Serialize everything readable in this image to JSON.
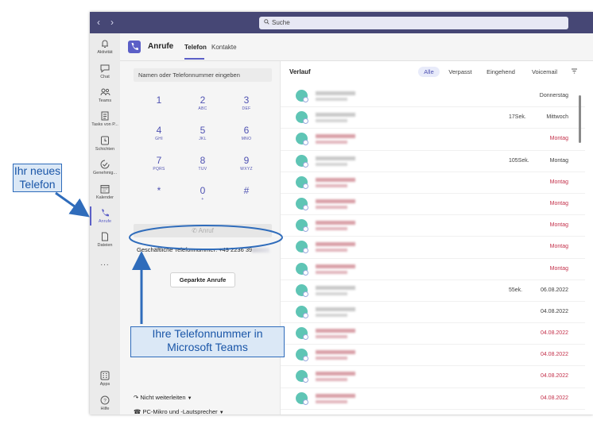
{
  "search": {
    "placeholder": "Suche"
  },
  "rail": [
    {
      "label": "Aktivität",
      "icon": "bell-icon"
    },
    {
      "label": "Chat",
      "icon": "chat-icon"
    },
    {
      "label": "Teams",
      "icon": "teams-icon"
    },
    {
      "label": "Tasks von P...",
      "icon": "tasks-icon"
    },
    {
      "label": "Schichten",
      "icon": "shifts-icon"
    },
    {
      "label": "Genehmig...",
      "icon": "approvals-icon"
    },
    {
      "label": "Kalender",
      "icon": "calendar-icon"
    },
    {
      "label": "Anrufe",
      "icon": "phone-icon"
    },
    {
      "label": "Dateien",
      "icon": "file-icon"
    },
    {
      "label": "...",
      "icon": "more-icon"
    }
  ],
  "rail_bottom": [
    {
      "label": "Apps",
      "icon": "apps-icon"
    },
    {
      "label": "Hilfe",
      "icon": "help-icon"
    }
  ],
  "header": {
    "title": "Anrufe",
    "tabs": [
      "Telefon",
      "Kontakte"
    ]
  },
  "dialer": {
    "input_placeholder": "Namen oder Telefonnummer eingeben",
    "keys": [
      {
        "digit": "1",
        "sub": ""
      },
      {
        "digit": "2",
        "sub": "ABC"
      },
      {
        "digit": "3",
        "sub": "DEF"
      },
      {
        "digit": "4",
        "sub": "GHI"
      },
      {
        "digit": "5",
        "sub": "JKL"
      },
      {
        "digit": "6",
        "sub": "MNO"
      },
      {
        "digit": "7",
        "sub": "PQRS"
      },
      {
        "digit": "8",
        "sub": "TUV"
      },
      {
        "digit": "9",
        "sub": "WXYZ"
      },
      {
        "digit": "*",
        "sub": ""
      },
      {
        "digit": "0",
        "sub": "+"
      },
      {
        "digit": "#",
        "sub": ""
      }
    ],
    "call_label": "Anruf",
    "business_number": "Geschäftliche Telefonnummer: +49 2236 39",
    "parked_calls": "Geparkte Anrufe",
    "forwarding": "Nicht weiterleiten",
    "audio_device": "PC-Mikro und -Lautsprecher"
  },
  "history": {
    "title": "Verlauf",
    "filters": [
      "Alle",
      "Verpasst",
      "Eingehend",
      "Voicemail"
    ],
    "active_filter": "Alle",
    "rows": [
      {
        "missed": false,
        "duration": "",
        "date": "Donnerstag"
      },
      {
        "missed": false,
        "duration": "17Sek.",
        "date": "Mittwoch"
      },
      {
        "missed": true,
        "duration": "",
        "date": "Montag"
      },
      {
        "missed": false,
        "duration": "105Sek.",
        "date": "Montag"
      },
      {
        "missed": true,
        "duration": "",
        "date": "Montag"
      },
      {
        "missed": true,
        "duration": "",
        "date": "Montag"
      },
      {
        "missed": true,
        "duration": "",
        "date": "Montag"
      },
      {
        "missed": true,
        "duration": "",
        "date": "Montag"
      },
      {
        "missed": true,
        "duration": "",
        "date": "Montag"
      },
      {
        "missed": false,
        "duration": "55ek.",
        "date": "06.08.2022"
      },
      {
        "missed": false,
        "duration": "",
        "date": "04.08.2022"
      },
      {
        "missed": true,
        "duration": "",
        "date": "04.08.2022"
      },
      {
        "missed": true,
        "duration": "",
        "date": "04.08.2022"
      },
      {
        "missed": true,
        "duration": "",
        "date": "04.08.2022"
      },
      {
        "missed": true,
        "duration": "",
        "date": "04.08.2022"
      }
    ]
  },
  "annotations": {
    "new_phone": "Ihr neues Telefon",
    "your_number": "Ihre Telefonnummer in Microsoft Teams"
  },
  "colors": {
    "accent": "#5b5fc7",
    "titlebar": "#464775",
    "missed": "#c4314b",
    "avatar": "#5fc5b5",
    "callout": "#2f6cbb"
  }
}
